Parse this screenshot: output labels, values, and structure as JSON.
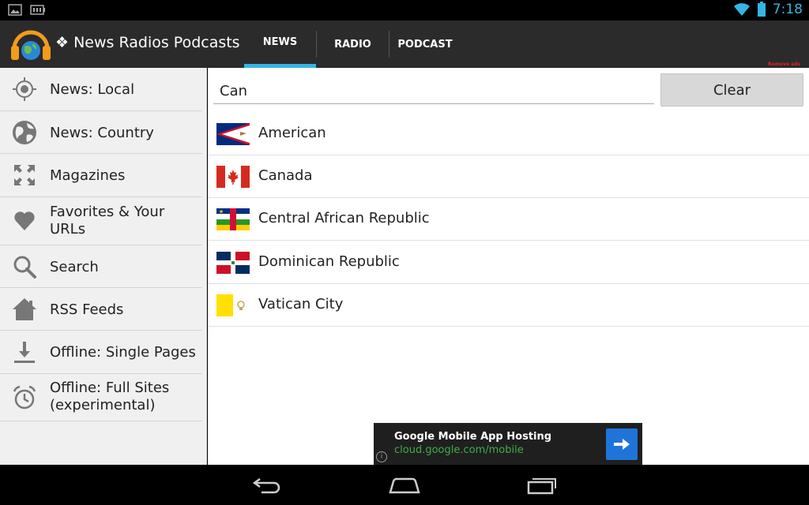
{
  "status_bar": {
    "time": "7:18",
    "left_icons": [
      "image-icon",
      "battery-saver-icon"
    ],
    "right_icons": [
      "wifi-icon",
      "battery-icon"
    ]
  },
  "action_bar": {
    "title": "❖ News Radios Podcasts",
    "tabs": [
      {
        "label": "NEWS",
        "selected": true
      },
      {
        "label": "RADIO",
        "selected": false
      },
      {
        "label": "PODCAST",
        "selected": false
      }
    ],
    "remove_ads_label": "Remove ads"
  },
  "sidebar": {
    "items": [
      {
        "label": "News: Local",
        "icon": "crosshair-icon"
      },
      {
        "label": "News: Country",
        "icon": "globe-icon"
      },
      {
        "label": "Magazines",
        "icon": "expand-icon"
      },
      {
        "label": "Favorites & Your URLs",
        "icon": "heart-icon"
      },
      {
        "label": "Search",
        "icon": "search-icon"
      },
      {
        "label": "RSS Feeds",
        "icon": "home-icon"
      },
      {
        "label": "Offline: Single Pages",
        "icon": "download-icon"
      },
      {
        "label": "Offline: Full Sites (experimental)",
        "icon": "alarm-icon"
      }
    ]
  },
  "search": {
    "value": "Can",
    "clear_label": "Clear"
  },
  "countries": [
    {
      "name": "American",
      "flag": "american-samoa-flag-icon"
    },
    {
      "name": "Canada",
      "flag": "canada-flag-icon"
    },
    {
      "name": "Central African Republic",
      "flag": "central-african-republic-flag-icon"
    },
    {
      "name": "Dominican Republic",
      "flag": "dominican-republic-flag-icon"
    },
    {
      "name": "Vatican City",
      "flag": "vatican-flag-icon"
    }
  ],
  "ad": {
    "title": "Google Mobile App Hosting",
    "url": "cloud.google.com/mobile",
    "info_glyph": "i"
  },
  "colors": {
    "accent": "#33b5e5",
    "action_bar": "#2b2b2b",
    "ad_url": "#3cb043",
    "ad_button": "#1e74d9",
    "remove_ads": "#e02020"
  }
}
